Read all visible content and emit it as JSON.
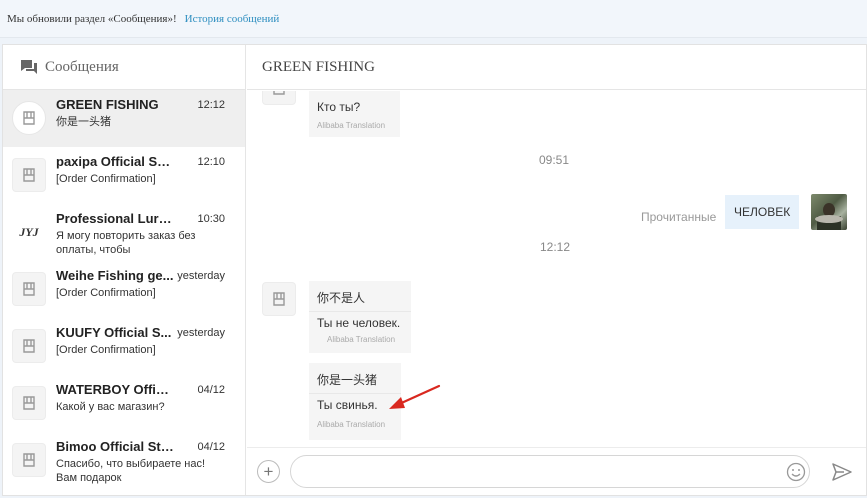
{
  "notice": {
    "text": "Мы обновили раздел «Сообщения»!",
    "link": "История сообщений"
  },
  "sidebar": {
    "title": "Сообщения",
    "conversations": [
      {
        "name": "GREEN FISHING",
        "time": "12:12",
        "preview": "你是一头猪",
        "active": true
      },
      {
        "name": "paxipa Official Store",
        "time": "12:10",
        "preview": "[Order Confirmation]"
      },
      {
        "name": "Professional Lure st...",
        "time": "10:30",
        "preview": "Я могу повторить заказ без оплаты, чтобы",
        "logo": "JYJ"
      },
      {
        "name": "Weihe Fishing ge...",
        "time": "yesterday",
        "preview": "[Order Confirmation]"
      },
      {
        "name": "KUUFY Official S...",
        "time": "yesterday",
        "preview": "[Order Confirmation]"
      },
      {
        "name": "WATERBOY Official ...",
        "time": "04/12",
        "preview": "Какой у вас магазин?"
      },
      {
        "name": "Bimoo Official Store",
        "time": "04/12",
        "preview": "Спасибо, что выбираете нас! Вам подарок"
      }
    ]
  },
  "chat": {
    "title": "GREEN FISHING",
    "messages": {
      "m1": {
        "translation": "Кто ты?",
        "source": "Alibaba Translation"
      },
      "ts1": "09:51",
      "read_label": "Прочитанные",
      "mine": "ЧЕЛОВЕК",
      "ts2": "12:12",
      "m2": {
        "original": "你不是人",
        "translation": "Ты не человек.",
        "source": "Alibaba Translation"
      },
      "m3": {
        "original": "你是一头猪",
        "translation": "Ты свинья.",
        "source": "Alibaba Translation"
      }
    },
    "compose": {
      "placeholder": "",
      "value": ""
    }
  },
  "colors": {
    "accent_link": "#2f8fc0",
    "arrow": "#d9281f",
    "mine_bubble": "#e6f1fb"
  }
}
